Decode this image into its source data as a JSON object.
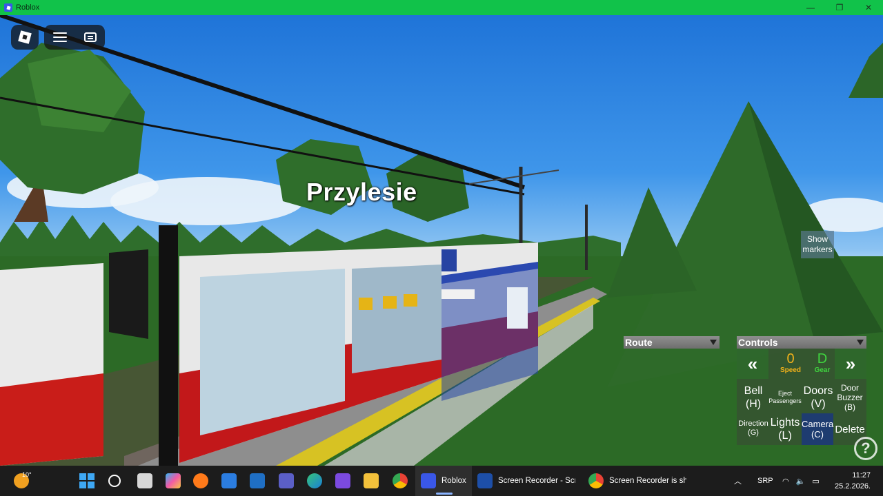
{
  "window": {
    "title": "Roblox",
    "controls": {
      "minimize": "—",
      "restore": "❐",
      "close": "✕"
    }
  },
  "game": {
    "station_name": "Przylesie",
    "show_markers_label": "Show markers",
    "route_label": "Route",
    "controls_label": "Controls",
    "controls": {
      "prev": "«",
      "next": "»",
      "speed_value": "0",
      "speed_label": "Speed",
      "gear_value": "D",
      "gear_label": "Gear",
      "bell": "Bell",
      "bell_key": "(H)",
      "eject": "Eject Passengers",
      "doors": "Doors",
      "doors_key": "(V)",
      "door_buzzer": "Door Buzzer",
      "door_buzzer_key": "(B)",
      "direction": "Direction",
      "direction_key": "(G)",
      "lights": "Lights",
      "lights_key": "(L)",
      "camera": "Camera",
      "camera_key": "(C)",
      "delete": "Delete"
    },
    "help": "?",
    "colors": {
      "speed": "#f2b21a",
      "gear": "#3fd43f",
      "titlebar": "#11c24a"
    }
  },
  "taskbar": {
    "weather_temp": "10°",
    "apps": [
      {
        "name": "Roblox",
        "label": "Roblox"
      },
      {
        "name": "Screen Recorder",
        "label": "Screen Recorder - Scr"
      },
      {
        "name": "Chrome",
        "label": "Screen Recorder is sha"
      }
    ],
    "language": "SRP",
    "time": "11:27",
    "date": "25.2.2026."
  }
}
